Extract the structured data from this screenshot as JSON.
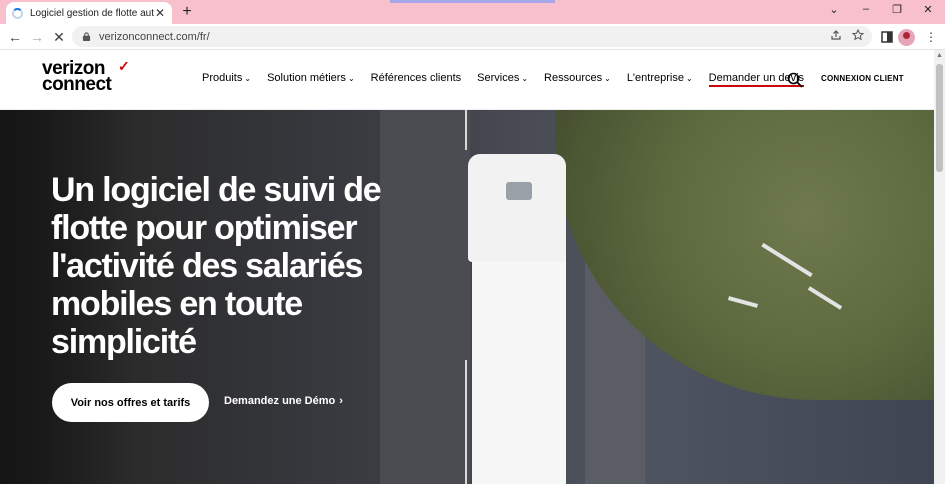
{
  "browser": {
    "tab_title": "Logiciel gestion de flotte automo",
    "tab_close": "✕",
    "new_tab": "+",
    "window_controls": [
      "⌄",
      "–",
      "❐",
      "✕"
    ],
    "url": "verizonconnect.com/fr/",
    "back": "←",
    "forward": "→",
    "reload": "✕",
    "menu": "⋮"
  },
  "site": {
    "logo_line1": "verizon",
    "logo_line2": "connect",
    "logo_check": "✓",
    "nav": [
      {
        "label": "Produits",
        "dropdown": true
      },
      {
        "label": "Solution métiers",
        "dropdown": true
      },
      {
        "label": "Références clients",
        "dropdown": false
      },
      {
        "label": "Services",
        "dropdown": true
      },
      {
        "label": "Ressources",
        "dropdown": true
      },
      {
        "label": "L'entreprise",
        "dropdown": true
      },
      {
        "label": "Demander un devis",
        "dropdown": false
      }
    ],
    "chevron": "⌄",
    "login": "CONNEXION CLIENT"
  },
  "hero": {
    "title": "Un logiciel de suivi de flotte pour optimiser l'activité des salariés mobiles en toute simplicité",
    "cta_primary": "Voir nos offres et tarifs",
    "cta_secondary": "Demandez une Démo",
    "cta_secondary_chevron": "›"
  },
  "colors": {
    "tabstrip": "#f7c0cc",
    "brand_red": "#cd040b"
  }
}
